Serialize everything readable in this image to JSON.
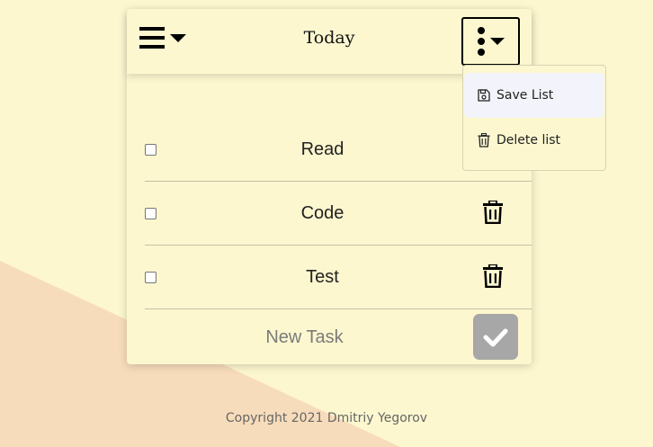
{
  "colors": {
    "background": "#fcf7cf",
    "accent_shape": "#f7dcbb",
    "submit_button": "#a7a7a7"
  },
  "header": {
    "title": "Today",
    "menu_icon": "hamburger-menu-icon",
    "options_icon": "kebab-menu-icon"
  },
  "tasks": [
    {
      "label": "Read",
      "checked": false
    },
    {
      "label": "Code",
      "checked": false
    },
    {
      "label": "Test",
      "checked": false
    }
  ],
  "new_task": {
    "placeholder": "New Task",
    "value": "",
    "submit_icon": "checkmark-icon"
  },
  "dropdown": {
    "items": [
      {
        "label": "Save List",
        "icon": "save-icon"
      },
      {
        "label": "Delete list",
        "icon": "trash-icon"
      }
    ]
  },
  "footer": {
    "text": "Copyright 2021 Dmitriy Yegorov"
  }
}
